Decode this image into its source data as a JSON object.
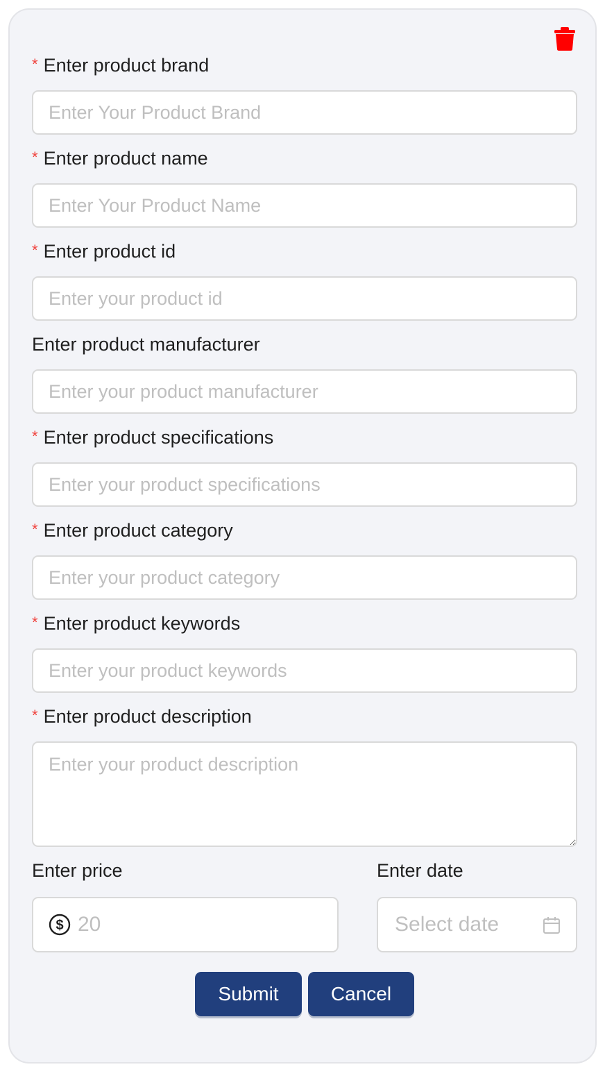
{
  "form": {
    "fields": [
      {
        "label": "Enter product brand",
        "required": true,
        "placeholder": "Enter Your Product Brand"
      },
      {
        "label": "Enter product name",
        "required": true,
        "placeholder": "Enter Your Product Name"
      },
      {
        "label": "Enter product id",
        "required": true,
        "placeholder": "Enter your product id"
      },
      {
        "label": "Enter product manufacturer",
        "required": false,
        "placeholder": "Enter your product manufacturer"
      },
      {
        "label": "Enter product specifications",
        "required": true,
        "placeholder": "Enter your product specifications"
      },
      {
        "label": "Enter product category",
        "required": true,
        "placeholder": "Enter your product category"
      },
      {
        "label": "Enter product keywords",
        "required": true,
        "placeholder": "Enter your product keywords"
      },
      {
        "label": "Enter product description",
        "required": true,
        "placeholder": "Enter your product description"
      }
    ],
    "required_mark": "*",
    "price": {
      "label": "Enter price",
      "placeholder": "20",
      "icon": "dollar-circle-icon"
    },
    "date": {
      "label": "Enter date",
      "placeholder": "Select date",
      "icon": "calendar-icon"
    },
    "buttons": {
      "submit": "Submit",
      "cancel": "Cancel"
    },
    "delete_icon": "trash-icon"
  },
  "colors": {
    "card_bg": "#f3f4f8",
    "required": "#f0413c",
    "button": "#213f7d",
    "trash": "#ff0000",
    "placeholder": "#bfbfbf"
  }
}
